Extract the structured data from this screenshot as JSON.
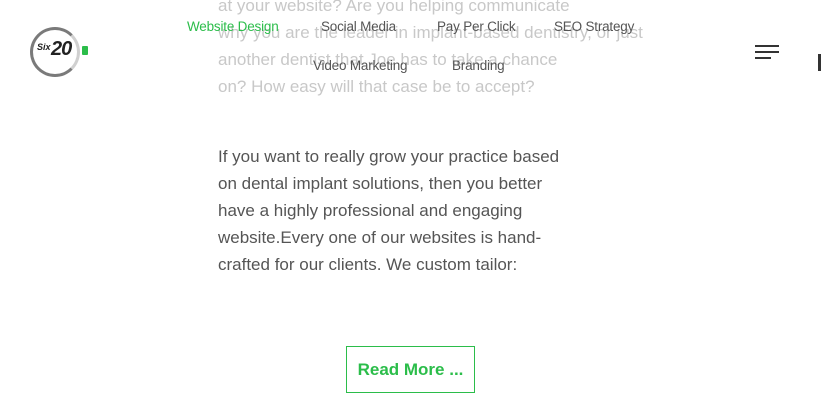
{
  "logo": {
    "six": "Six",
    "twenty": "20"
  },
  "nav": {
    "website_design": "Website Design",
    "social_media": "Social Media",
    "pay_per_click": "Pay Per Click",
    "seo_strategy": "SEO Strategy",
    "video_marketing": "Video Marketing",
    "branding": "Branding"
  },
  "faded_text": {
    "line1": "at your website? Are you helping communicate",
    "line2": "why you are the leader in implant-based dentistry, or just",
    "line3": "another dentist that Joe has to take a chance",
    "line4": "on? How easy will that case be to accept?"
  },
  "article": {
    "line1": "If you want to really grow your practice based",
    "line2": "on dental implant solutions, then you better",
    "line3": "have a highly professional and engaging",
    "line4": "website.Every one of our websites is hand-",
    "line5": "crafted for our clients. We custom tailor:"
  },
  "read_more": "Read More ...",
  "colors": {
    "accent": "#2bbd4a",
    "text": "#555555"
  },
  "icons": {
    "menu": "hamburger-menu-icon"
  }
}
